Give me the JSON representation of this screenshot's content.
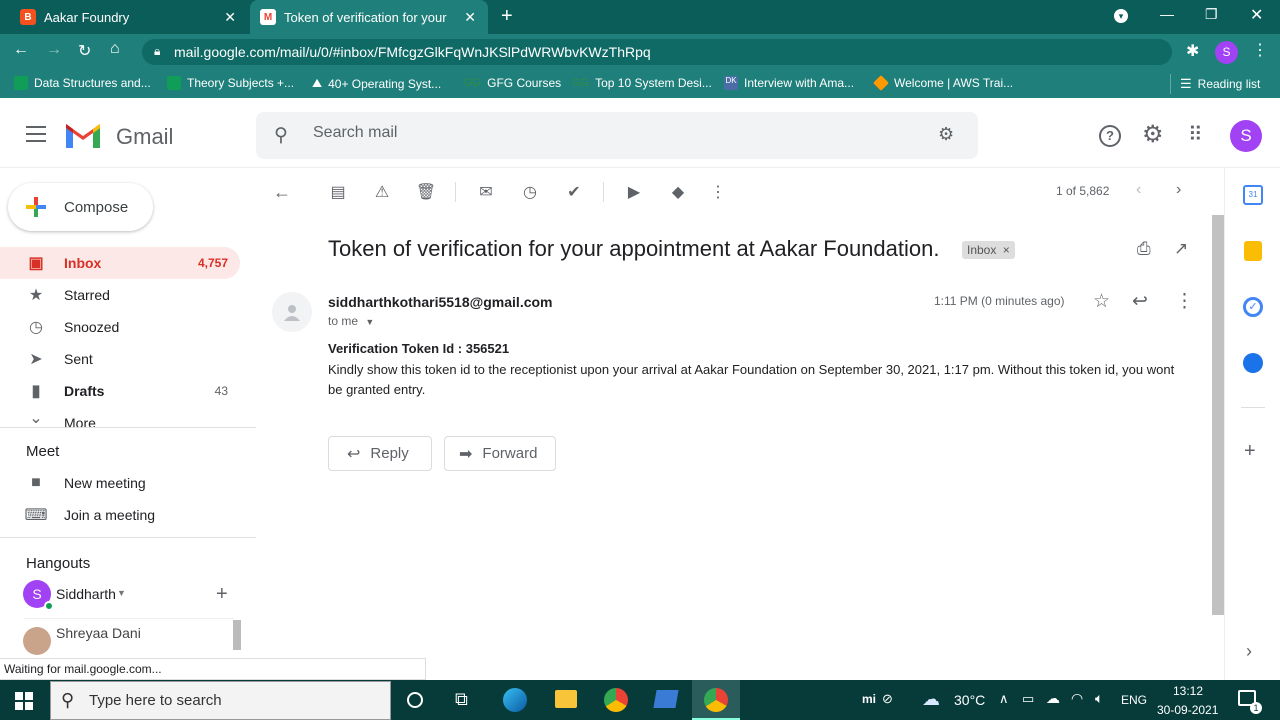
{
  "browser": {
    "tabs": [
      {
        "title": "Aakar Foundry",
        "active": false
      },
      {
        "title": "Token of verification for your app",
        "active": true
      }
    ],
    "url": "mail.google.com/mail/u/0/#inbox/FMfcgzGlkFqWnJKSlPdWRWbvKWzThRpq",
    "profile_initial": "S",
    "bookmarks": [
      "Data Structures and...",
      "Theory Subjects +...",
      "40+ Operating Syst...",
      "GFG Courses",
      "Top 10 System Desi...",
      "Interview with Ama...",
      "Welcome | AWS Trai..."
    ],
    "reading_list": "Reading list"
  },
  "gmail": {
    "logo_text": "Gmail",
    "search_placeholder": "Search mail",
    "avatar_initial": "S",
    "compose": "Compose",
    "nav": [
      {
        "label": "Inbox",
        "count": "4,757"
      },
      {
        "label": "Starred",
        "count": ""
      },
      {
        "label": "Snoozed",
        "count": ""
      },
      {
        "label": "Sent",
        "count": ""
      },
      {
        "label": "Drafts",
        "count": "43"
      },
      {
        "label": "More",
        "count": ""
      }
    ],
    "meet": {
      "title": "Meet",
      "new_meeting": "New meeting",
      "join_meeting": "Join a meeting"
    },
    "hangouts": {
      "title": "Hangouts",
      "user": "Siddharth",
      "user_initial": "S",
      "contact": "Shreyaa Dani"
    },
    "pagination": "1 of 5,862",
    "email": {
      "subject": "Token of verification for your appointment at Aakar Foundation.",
      "label": "Inbox",
      "sender": "siddharthkothari5518@gmail.com",
      "to": "to me",
      "time": "1:11 PM (0 minutes ago)",
      "body_title": "Verification Token Id : 356521",
      "body_text": "Kindly show this token id to the receptionist upon your arrival at Aakar Foundation on September 30, 2021, 1:17 pm. Without this token id, you wont be granted entry."
    },
    "reply": "Reply",
    "forward": "Forward"
  },
  "status_bar": "Waiting for mail.google.com...",
  "taskbar": {
    "search_placeholder": "Type here to search",
    "weather": "30°C",
    "lang": "ENG",
    "time": "13:12",
    "date": "30-09-2021",
    "notification_count": "1"
  }
}
